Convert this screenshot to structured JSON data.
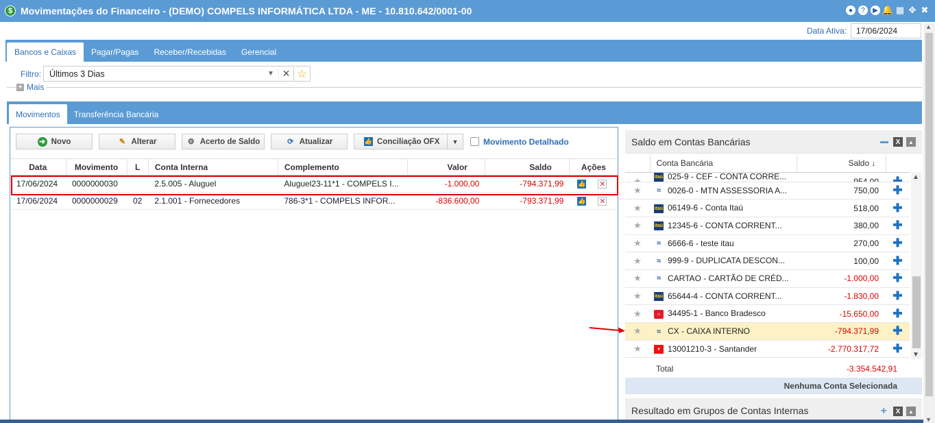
{
  "window": {
    "title": "Movimentações do Financeiro - (DEMO) COMPELS INFORMÁTICA LTDA - ME - 10.810.642/0001-00"
  },
  "date_bar": {
    "label": "Data Ativa:",
    "value": "17/06/2024"
  },
  "main_tabs": [
    {
      "label": "Bancos e Caixas",
      "active": true
    },
    {
      "label": "Pagar/Pagas",
      "active": false
    },
    {
      "label": "Receber/Recebidas",
      "active": false
    },
    {
      "label": "Gerencial",
      "active": false
    }
  ],
  "filter": {
    "label": "Filtro:",
    "value": "Últimos 3 Dias"
  },
  "mais": {
    "label": "Mais"
  },
  "sub_tabs": [
    {
      "label": "Movimentos",
      "active": true
    },
    {
      "label": "Transferência Bancária",
      "active": false
    }
  ],
  "toolbar": {
    "novo": "Novo",
    "alterar": "Alterar",
    "acerto": "Acerto de Saldo",
    "atualizar": "Atualizar",
    "conciliacao": "Conciliação OFX",
    "detalhado": "Movimento Detalhado"
  },
  "movements": {
    "columns": [
      "Data",
      "Movimento",
      "L",
      "Conta Interna",
      "Complemento",
      "Valor",
      "Saldo",
      "Ações"
    ],
    "rows": [
      {
        "data": "17/06/2024",
        "movimento": "0000000030",
        "l": "",
        "conta": "2.5.005 - Aluguel",
        "complemento": "Aluguel23-11*1 - COMPELS I...",
        "valor": "-1.000,00",
        "saldo": "-794.371,99"
      },
      {
        "data": "17/06/2024",
        "movimento": "0000000029",
        "l": "02",
        "conta": "2.1.001 - Fornecedores",
        "complemento": "786-3*1 - COMPELS INFOR...",
        "valor": "-836.600,00",
        "saldo": "-793.371,99"
      }
    ],
    "highlighted_row": 0
  },
  "accounts_panel": {
    "title": "Saldo em Contas Bancárias",
    "columns": [
      "Conta Bancária",
      "Saldo"
    ],
    "rows": [
      {
        "bank": "itau",
        "name": "025-9 - CEF - CONTA CORRE...",
        "saldo": "954,00",
        "neg": false
      },
      {
        "bank": "sw",
        "name": "0026-0 - MTN ASSESSORIA A...",
        "saldo": "750,00",
        "neg": false
      },
      {
        "bank": "itau",
        "name": "06149-6 - Conta Itaú",
        "saldo": "518,00",
        "neg": false
      },
      {
        "bank": "itau",
        "name": "12345-6 - CONTA CORRENT...",
        "saldo": "380,00",
        "neg": false
      },
      {
        "bank": "sw",
        "name": "6666-6 - teste itau",
        "saldo": "270,00",
        "neg": false
      },
      {
        "bank": "sw",
        "name": "999-9 - DUPLICATA DESCON...",
        "saldo": "100,00",
        "neg": false
      },
      {
        "bank": "sw",
        "name": "CARTAO - CARTÃO DE CRÉD...",
        "saldo": "-1.000,00",
        "neg": true
      },
      {
        "bank": "itau",
        "name": "65644-4 - CONTA CORRENT...",
        "saldo": "-1.830,00",
        "neg": true
      },
      {
        "bank": "brad",
        "name": "34495-1 - Banco Bradesco",
        "saldo": "-15.650,00",
        "neg": true
      },
      {
        "bank": "sw",
        "name": "CX - CAIXA INTERNO",
        "saldo": "-794.371,99",
        "neg": true
      },
      {
        "bank": "sant",
        "name": "13001210-3 - Santander",
        "saldo": "-2.770.317,72",
        "neg": true
      }
    ],
    "selected_row": 9,
    "total_label": "Total",
    "total_value": "-3.354.542,91",
    "no_selection": "Nenhuma Conta Selecionada"
  },
  "groups_panel": {
    "title": "Resultado em Grupos de Contas Internas"
  },
  "colors": {
    "accent": "#5b9bd5",
    "negative": "#dd0000",
    "highlight": "#e00000",
    "selected_row": "#fdf1c6"
  }
}
